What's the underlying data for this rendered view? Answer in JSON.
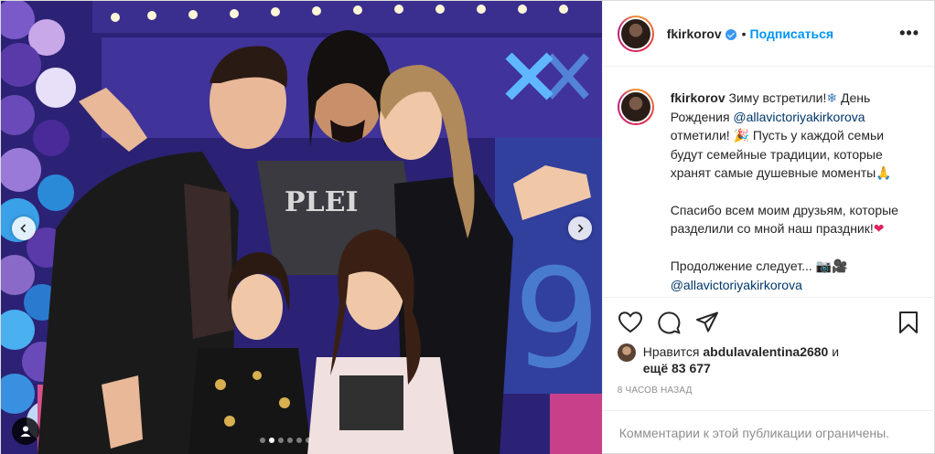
{
  "post": {
    "media": {
      "description_icon": "photo-carousel",
      "carousel_count": 6,
      "carousel_active": 1
    },
    "header": {
      "username": "fkirkorov",
      "separator": "•",
      "follow_label": "Подписаться",
      "more_label": "•••"
    },
    "caption": {
      "username": "fkirkorov",
      "line1": "Зиму встретили!",
      "line1_emoji": "❄",
      "line1b": " День Рождения ",
      "mention1": "@allavictoriyakirkorova",
      "line2": " отметили! ",
      "line2_emoji": "🎉",
      "line3": " Пусть у каждой семьи будут семейные традиции, которые хранят самые душевные моменты",
      "line3_emoji": "🙏",
      "paragraph2": "Спасибо всем моим друзьям, которые разделили со мной наш праздник!",
      "paragraph2_emoji": "❤",
      "paragraph3": "Продолжение следует... ",
      "paragraph3_emoji": "📷🎥",
      "mention2": "@allavictoriyakirkorova"
    },
    "likes": {
      "prefix": "Нравится ",
      "user": "abdulavalentina2680",
      "middle": " и",
      "more_prefix": "ещё ",
      "count": "83 677"
    },
    "timestamp": "8 часов назад",
    "comments_disabled": "Комментарии к этой публикации ограничены.",
    "colors": {
      "accent": "#0095f6",
      "verified": "#3897f0",
      "muted": "#8e8e8e"
    }
  }
}
